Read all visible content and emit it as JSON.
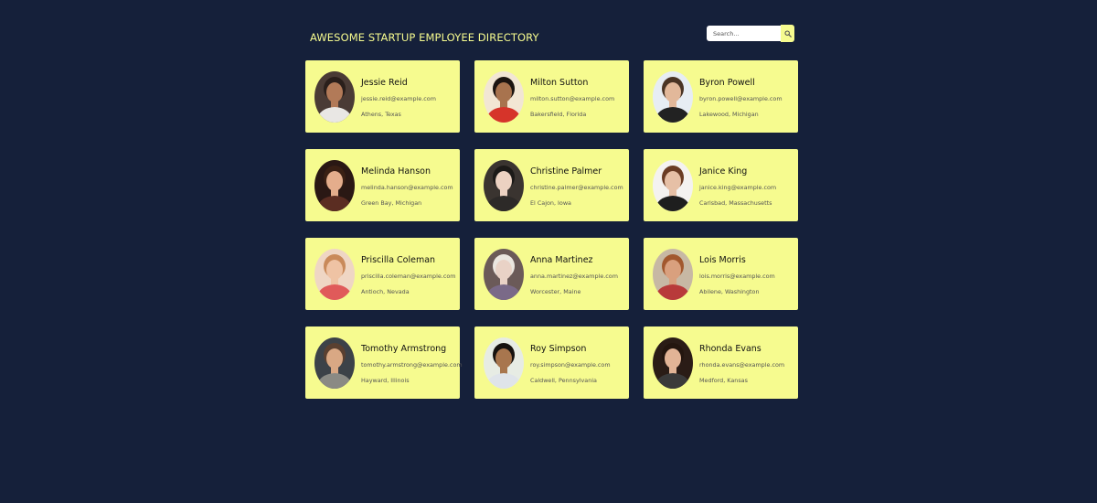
{
  "header": {
    "title": "AWESOME STARTUP EMPLOYEE DIRECTORY",
    "search_placeholder": "Search...",
    "search_icon": "search-icon"
  },
  "colors": {
    "background": "#15203a",
    "card": "#f6fb8f",
    "title": "#f6fb8f"
  },
  "employees": [
    {
      "name": "Jessie Reid",
      "email": "jessie.reid@example.com",
      "location": "Athens, Texas",
      "avatar": {
        "bg": "#4a3b35",
        "skin": "#b27a58",
        "hair": "#2a1f1b",
        "shirt": "#e9e7e4"
      }
    },
    {
      "name": "Milton Sutton",
      "email": "milton.sutton@example.com",
      "location": "Bakersfield, Florida",
      "avatar": {
        "bg": "#f2e6d4",
        "skin": "#a8734e",
        "hair": "#1c1410",
        "shirt": "#d6342a"
      }
    },
    {
      "name": "Byron Powell",
      "email": "byron.powell@example.com",
      "location": "Lakewood, Michigan",
      "avatar": {
        "bg": "#e7edf3",
        "skin": "#e2b89a",
        "hair": "#4a3424",
        "shirt": "#222222"
      }
    },
    {
      "name": "Melinda Hanson",
      "email": "melinda.hanson@example.com",
      "location": "Green Bay, Michigan",
      "avatar": {
        "bg": "#2a1814",
        "skin": "#e4ad8c",
        "hair": "#3a2014",
        "shirt": "#5b2d22"
      }
    },
    {
      "name": "Christine Palmer",
      "email": "christine.palmer@example.com",
      "location": "El Cajon, Iowa",
      "avatar": {
        "bg": "#3a3430",
        "skin": "#ecd2c2",
        "hair": "#1c1a18",
        "shirt": "#2d2a28"
      }
    },
    {
      "name": "Janice King",
      "email": "janice.king@example.com",
      "location": "Carlsbad, Massachusetts",
      "avatar": {
        "bg": "#f4f2f0",
        "skin": "#e6c0a6",
        "hair": "#6a3c24",
        "shirt": "#1e1e1e"
      }
    },
    {
      "name": "Priscilla Coleman",
      "email": "priscilla.coleman@example.com",
      "location": "Antioch, Nevada",
      "avatar": {
        "bg": "#efd6c4",
        "skin": "#efc3a4",
        "hair": "#c98a5a",
        "shirt": "#e05a5a"
      }
    },
    {
      "name": "Anna Martinez",
      "email": "anna.martinez@example.com",
      "location": "Worcester, Maine",
      "avatar": {
        "bg": "#6b5a58",
        "skin": "#e9d2c6",
        "hair": "#ebe6e0",
        "shirt": "#7a6a88"
      }
    },
    {
      "name": "Lois Morris",
      "email": "lois.morris@example.com",
      "location": "Abilene, Washington",
      "avatar": {
        "bg": "#c7b8a4",
        "skin": "#d9a07e",
        "hair": "#a2582e",
        "shirt": "#b83a3a"
      }
    },
    {
      "name": "Tomothy Armstrong",
      "email": "tomothy.armstrong@example.com",
      "location": "Hayward, Illinois",
      "avatar": {
        "bg": "#3c4248",
        "skin": "#d9a884",
        "hair": "#5a4030",
        "shirt": "#8a8a84"
      }
    },
    {
      "name": "Roy Simpson",
      "email": "roy.simpson@example.com",
      "location": "Caldwell, Pennsylvania",
      "avatar": {
        "bg": "#e7ece4",
        "skin": "#a8764e",
        "hair": "#16120f",
        "shirt": "#dfe4ea"
      }
    },
    {
      "name": "Rhonda Evans",
      "email": "rhonda.evans@example.com",
      "location": "Medford, Kansas",
      "avatar": {
        "bg": "#2a1c16",
        "skin": "#e2b496",
        "hair": "#24160f",
        "shirt": "#3a3a3a"
      }
    }
  ]
}
